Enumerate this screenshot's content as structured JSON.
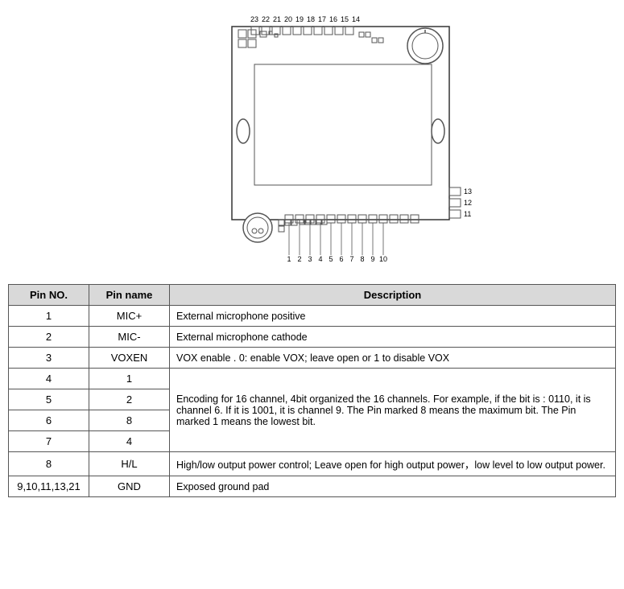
{
  "diagram": {
    "alt": "Module pin diagram showing top and bottom connector pins"
  },
  "table": {
    "headers": [
      "Pin NO.",
      "Pin name",
      "Description"
    ],
    "rows": [
      {
        "pin_no": "1",
        "pin_name": "MIC+",
        "description": "External microphone positive"
      },
      {
        "pin_no": "2",
        "pin_name": "MIC-",
        "description": "External microphone cathode"
      },
      {
        "pin_no": "3",
        "pin_name": "VOXEN",
        "description": "VOX enable . 0: enable VOX; leave open or 1 to disable VOX"
      },
      {
        "pin_no": "4",
        "pin_name": "1",
        "description": "Encoding for 16 channel, 4bit organized the 16 channels. For example, if the bit is : 0110, it is channel 6. If it is 1001, it is channel 9. The Pin marked 8 means the maximum bit. The Pin marked 1 means the lowest bit."
      },
      {
        "pin_no": "5",
        "pin_name": "2",
        "description": ""
      },
      {
        "pin_no": "6",
        "pin_name": "8",
        "description": ""
      },
      {
        "pin_no": "7",
        "pin_name": "4",
        "description": ""
      },
      {
        "pin_no": "8",
        "pin_name": "H/L",
        "description": "High/low output power control; Leave open for high output power，low level to low output power."
      },
      {
        "pin_no": "9,10,11,13,21",
        "pin_name": "GND",
        "description": "Exposed ground pad"
      }
    ]
  }
}
